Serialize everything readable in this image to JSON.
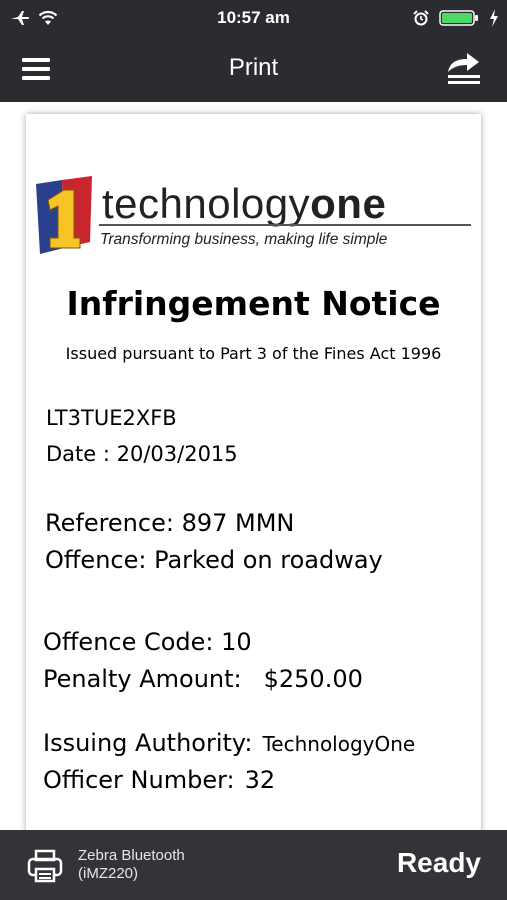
{
  "status_bar": {
    "time": "10:57 am",
    "icons": [
      "airplane-icon",
      "wifi-icon",
      "alarm-icon",
      "battery-icon",
      "charging-bolt-icon"
    ],
    "battery_color": "#4cd964"
  },
  "nav": {
    "title": "Print",
    "left_icon": "hamburger-menu-icon",
    "right_icon": "share-icon"
  },
  "notice": {
    "logo": {
      "wordmark_regular": "technology",
      "wordmark_bold": "one",
      "tagline": "Transforming business, making life simple"
    },
    "title": "Infringement Notice",
    "subtitle": "Issued pursuant to Part 3 of the Fines Act 1996",
    "notice_id": "LT3TUE2XFB",
    "date_line": "Date : 20/03/2015",
    "reference_line": "Reference: 897 MMN",
    "offence_line": "Offence: Parked on roadway",
    "offence_code_line": "Offence Code: 10",
    "penalty_label": "Penalty Amount:",
    "penalty_amount": "$250.00",
    "authority_label": "Issuing Authority:",
    "authority_value": "TechnologyOne",
    "officer_label": "Officer Number:",
    "officer_value": "32"
  },
  "printer": {
    "icon": "printer-icon",
    "name_line1": "Zebra Bluetooth",
    "name_line2": "(iMZ220)",
    "status": "Ready"
  },
  "colors": {
    "bars": "#2a2c2f",
    "bottom_bar": "#323437",
    "logo_blue": "#2b3f8f",
    "logo_red": "#c8252c",
    "logo_yellow": "#f6c426"
  }
}
